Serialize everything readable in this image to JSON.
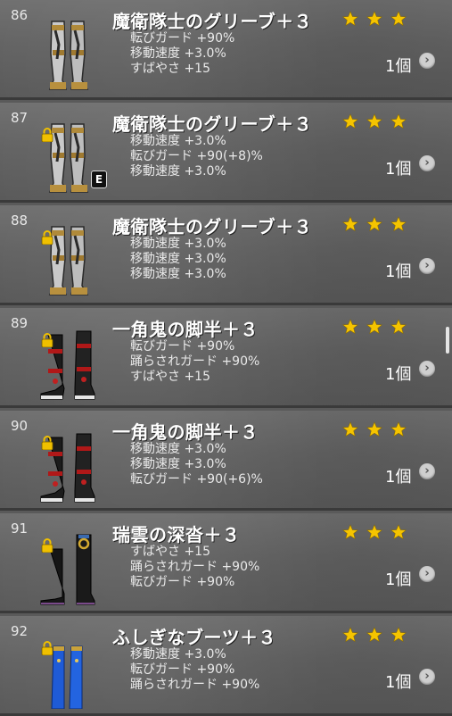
{
  "items": [
    {
      "number": "86",
      "name": "魔衛隊士のグリーブ＋３",
      "stats": [
        "転びガード +90%",
        "移動速度 +3.0%",
        "すばやさ +15"
      ],
      "count": "1個",
      "locked": false,
      "equipped": "",
      "icon": "silver-greaves-icon"
    },
    {
      "number": "87",
      "name": "魔衛隊士のグリーブ＋３",
      "stats": [
        "移動速度 +3.0%",
        "転びガード +90(+8)%",
        "移動速度 +3.0%"
      ],
      "count": "1個",
      "locked": true,
      "equipped": "E",
      "icon": "silver-greaves-icon"
    },
    {
      "number": "88",
      "name": "魔衛隊士のグリーブ＋３",
      "stats": [
        "移動速度 +3.0%",
        "移動速度 +3.0%",
        "移動速度 +3.0%"
      ],
      "count": "1個",
      "locked": true,
      "equipped": "",
      "icon": "silver-greaves-icon"
    },
    {
      "number": "89",
      "name": "一角鬼の脚半＋３",
      "stats": [
        "転びガード +90%",
        "踊らされガード +90%",
        "すばやさ +15"
      ],
      "count": "1個",
      "locked": true,
      "equipped": "",
      "icon": "black-red-boots-icon"
    },
    {
      "number": "90",
      "name": "一角鬼の脚半＋３",
      "stats": [
        "移動速度 +3.0%",
        "移動速度 +3.0%",
        "転びガード +90(+6)%"
      ],
      "count": "1個",
      "locked": true,
      "equipped": "",
      "icon": "black-red-boots-icon"
    },
    {
      "number": "91",
      "name": "瑞雲の深沓＋３",
      "stats": [
        "すばやさ +15",
        "踊らされガード +90%",
        "転びガード +90%"
      ],
      "count": "1個",
      "locked": true,
      "equipped": "",
      "icon": "black-boots-icon"
    },
    {
      "number": "92",
      "name": "ふしぎなブーツ＋３",
      "stats": [
        "移動速度 +3.0%",
        "転びガード +90%",
        "踊らされガード +90%"
      ],
      "count": "1個",
      "locked": true,
      "equipped": "",
      "icon": "blue-boots-icon"
    }
  ],
  "colors": {
    "star": "#f5c400",
    "row_bg": "#656565",
    "divider": "#3a3a3a"
  }
}
